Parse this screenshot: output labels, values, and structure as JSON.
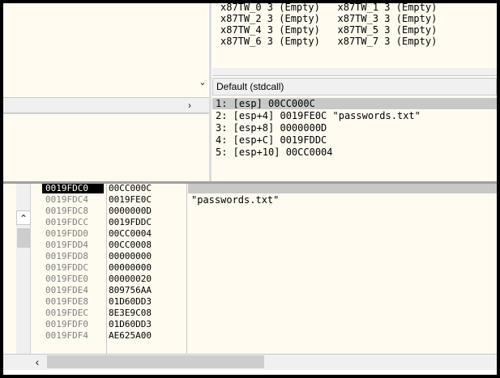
{
  "fpu": {
    "lines": [
      "x87TW_0 3 (Empty)   x87TW_1 3 (Empty)",
      "x87TW_2 3 (Empty)   x87TW_3 3 (Empty)",
      "x87TW_4 3 (Empty)   x87TW_5 3 (Empty)",
      "x87TW_6 3 (Empty)   x87TW_7 3 (Empty)"
    ]
  },
  "calling_convention": {
    "label": "Default (stdcall)"
  },
  "stack_args": [
    "1: [esp] 00CC000C",
    "2: [esp+4] 0019FE0C \"passwords.txt\"",
    "3: [esp+8] 0000000D",
    "4: [esp+C] 0019FDDC",
    "5: [esp+10] 00CC0004"
  ],
  "stack": {
    "rows": [
      {
        "addr": "0019FDC0",
        "value": "00CC000C",
        "comment": "",
        "selected": true
      },
      {
        "addr": "0019FDC4",
        "value": "0019FE0C",
        "comment": "\"passwords.txt\"",
        "selected": false
      },
      {
        "addr": "0019FDC8",
        "value": "0000000D",
        "comment": "",
        "selected": false
      },
      {
        "addr": "0019FDCC",
        "value": "0019FDDC",
        "comment": "",
        "selected": false
      },
      {
        "addr": "0019FDD0",
        "value": "00CC0004",
        "comment": "",
        "selected": false
      },
      {
        "addr": "0019FDD4",
        "value": "00CC0008",
        "comment": "",
        "selected": false
      },
      {
        "addr": "0019FDD8",
        "value": "00000000",
        "comment": "",
        "selected": false
      },
      {
        "addr": "0019FDDC",
        "value": "00000000",
        "comment": "",
        "selected": false
      },
      {
        "addr": "0019FDE0",
        "value": "00000020",
        "comment": "",
        "selected": false
      },
      {
        "addr": "0019FDE4",
        "value": "809756AA",
        "comment": "",
        "selected": false
      },
      {
        "addr": "0019FDE8",
        "value": "01D60DD3",
        "comment": "",
        "selected": false
      },
      {
        "addr": "0019FDEC",
        "value": "8E3E9C08",
        "comment": "",
        "selected": false
      },
      {
        "addr": "0019FDF0",
        "value": "01D60DD3",
        "comment": "",
        "selected": false
      },
      {
        "addr": "0019FDF4",
        "value": "AE625A00",
        "comment": "",
        "selected": false
      }
    ]
  },
  "icons": {
    "dropdown": "chevron-down-icon",
    "scroll_right": "chevron-right-icon",
    "scroll_up": "chevron-up-icon",
    "scroll_down": "chevron-down-icon",
    "scroll_left": "chevron-left-icon"
  },
  "colors": {
    "pane_bg": "#fffbf0",
    "selection": "#000000",
    "highlight": "#c8c8c8"
  }
}
